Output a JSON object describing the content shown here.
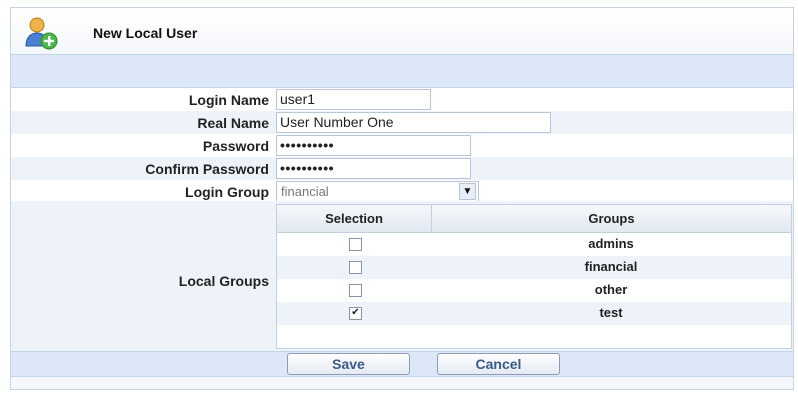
{
  "header": {
    "title": "New Local User",
    "icon": "user-add-icon"
  },
  "form": {
    "login_name": {
      "label": "Login Name",
      "value": "user1"
    },
    "real_name": {
      "label": "Real Name",
      "value": "User Number One"
    },
    "password": {
      "label": "Password",
      "value": "••••••••••"
    },
    "confirm_password": {
      "label": "Confirm Password",
      "value": "••••••••••"
    },
    "login_group": {
      "label": "Login Group",
      "value": "financial"
    },
    "local_groups": {
      "label": "Local Groups"
    }
  },
  "groups_table": {
    "headers": [
      "Selection",
      "Groups"
    ],
    "rows": [
      {
        "name": "admins",
        "checked": false
      },
      {
        "name": "financial",
        "checked": false
      },
      {
        "name": "other",
        "checked": false
      },
      {
        "name": "test",
        "checked": true,
        "mark": "✔"
      }
    ]
  },
  "buttons": {
    "save": "Save",
    "cancel": "Cancel"
  }
}
